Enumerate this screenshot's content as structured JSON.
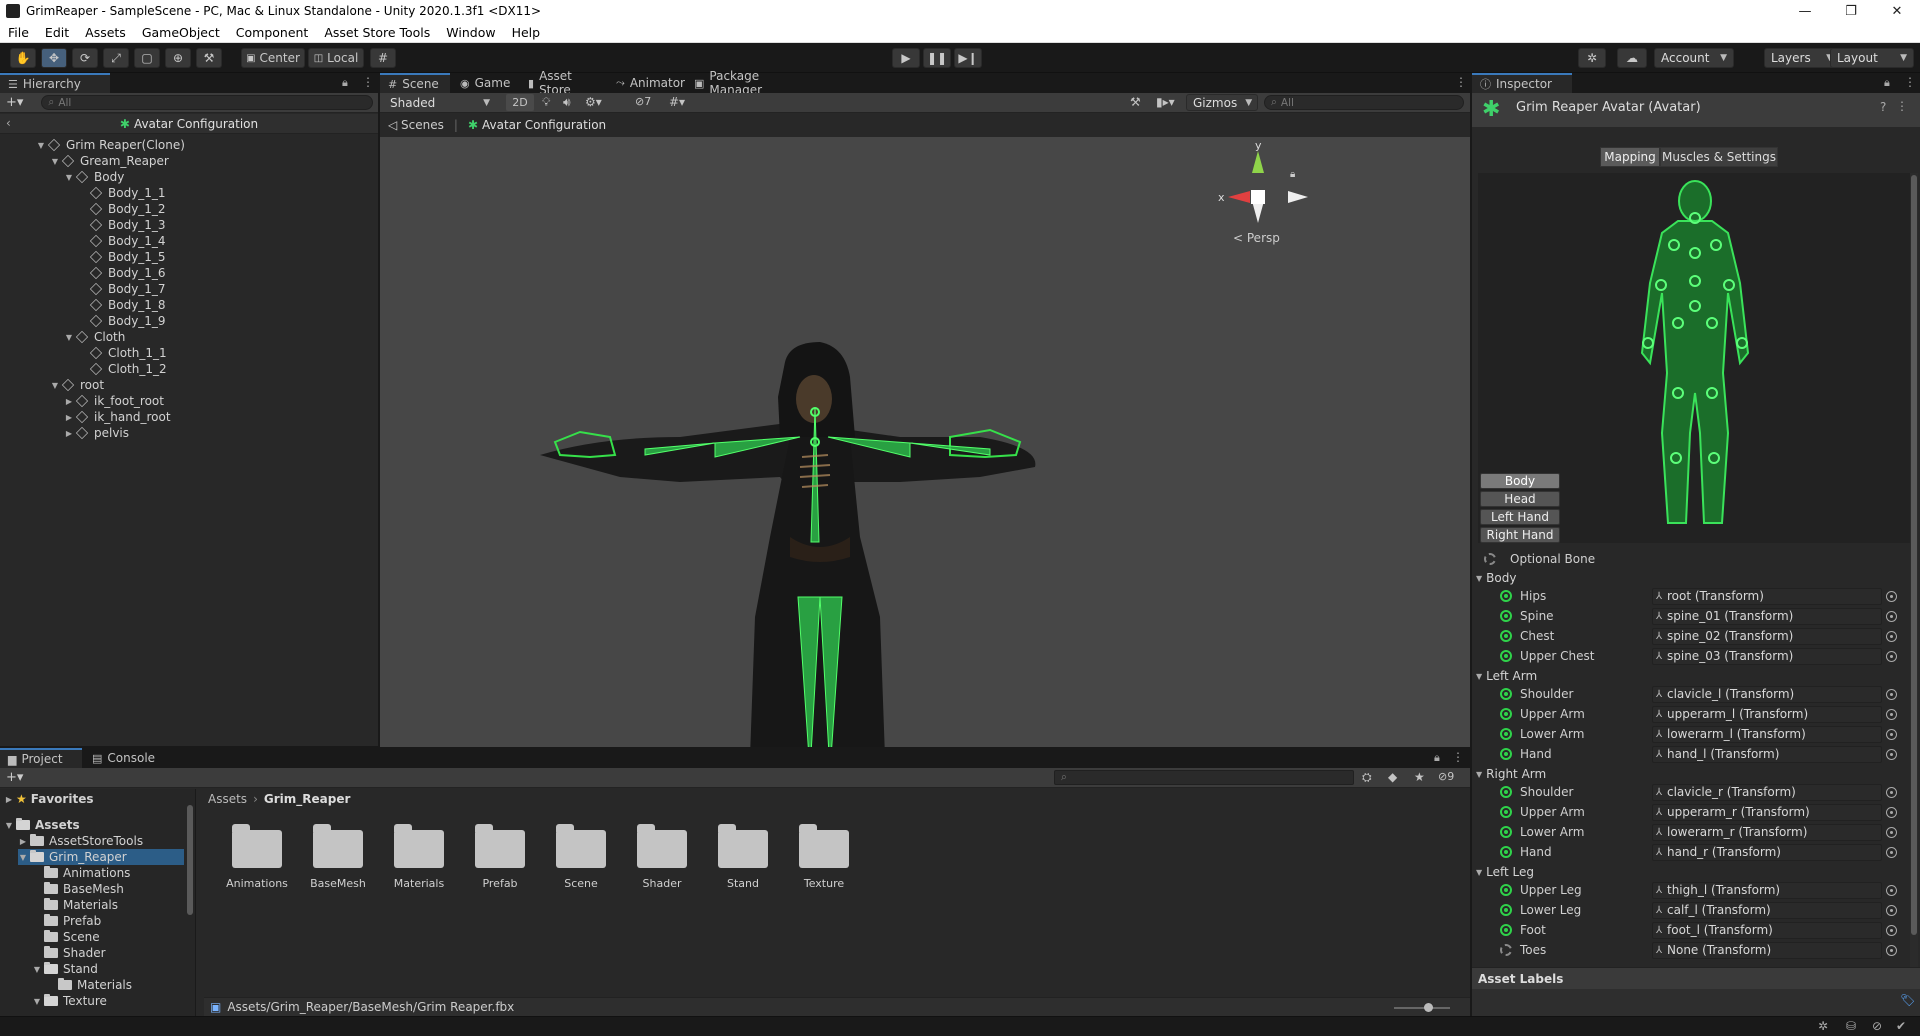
{
  "window": {
    "title": "GrimReaper - SampleScene - PC, Mac & Linux Standalone - Unity 2020.1.3f1 <DX11>"
  },
  "menu": [
    "File",
    "Edit",
    "Assets",
    "GameObject",
    "Component",
    "Asset Store Tools",
    "Window",
    "Help"
  ],
  "toolbar": {
    "pivot": "Center",
    "space": "Local",
    "account": "Account",
    "layers": "Layers",
    "layout": "Layout"
  },
  "hierarchy": {
    "tab": "Hierarchy",
    "search_placeholder": "All",
    "header": "Avatar Configuration",
    "items": [
      {
        "label": "Grim Reaper(Clone)",
        "depth": 0,
        "expand": "open"
      },
      {
        "label": "Gream_Reaper",
        "depth": 1,
        "expand": "open"
      },
      {
        "label": "Body",
        "depth": 2,
        "expand": "open"
      },
      {
        "label": "Body_1_1",
        "depth": 3,
        "expand": "none"
      },
      {
        "label": "Body_1_2",
        "depth": 3,
        "expand": "none"
      },
      {
        "label": "Body_1_3",
        "depth": 3,
        "expand": "none"
      },
      {
        "label": "Body_1_4",
        "depth": 3,
        "expand": "none"
      },
      {
        "label": "Body_1_5",
        "depth": 3,
        "expand": "none"
      },
      {
        "label": "Body_1_6",
        "depth": 3,
        "expand": "none"
      },
      {
        "label": "Body_1_7",
        "depth": 3,
        "expand": "none"
      },
      {
        "label": "Body_1_8",
        "depth": 3,
        "expand": "none"
      },
      {
        "label": "Body_1_9",
        "depth": 3,
        "expand": "none"
      },
      {
        "label": "Cloth",
        "depth": 2,
        "expand": "open"
      },
      {
        "label": "Cloth_1_1",
        "depth": 3,
        "expand": "none"
      },
      {
        "label": "Cloth_1_2",
        "depth": 3,
        "expand": "none"
      },
      {
        "label": "root",
        "depth": 1,
        "expand": "open"
      },
      {
        "label": "ik_foot_root",
        "depth": 2,
        "expand": "closed"
      },
      {
        "label": "ik_hand_root",
        "depth": 2,
        "expand": "closed"
      },
      {
        "label": "pelvis",
        "depth": 2,
        "expand": "closed"
      }
    ]
  },
  "scene_tabs": [
    {
      "label": "Scene",
      "icon": "#"
    },
    {
      "label": "Game",
      "icon": "◉"
    },
    {
      "label": "Asset Store",
      "icon": "▮"
    },
    {
      "label": "Animator",
      "icon": "⤳"
    },
    {
      "label": "Package Manager",
      "icon": "▣"
    }
  ],
  "scene": {
    "shading": "Shaded",
    "mode_2d": "2D",
    "hidden_count": "7",
    "gizmos": "Gizmos",
    "search_placeholder": "All",
    "breadcrumb_root": "Scenes",
    "breadcrumb_current": "Avatar Configuration",
    "gizmo_x": "x",
    "gizmo_y": "y",
    "projection": "Persp"
  },
  "inspector": {
    "tab": "Inspector",
    "title": "Grim Reaper Avatar (Avatar)",
    "mode_tabs": [
      "Mapping",
      "Muscles & Settings"
    ],
    "body_buttons": [
      "Body",
      "Head",
      "Left Hand",
      "Right Hand"
    ],
    "optional_bone": "Optional Bone",
    "sections": [
      {
        "name": "Body",
        "rows": [
          {
            "label": "Hips",
            "value": "root (Transform)",
            "optional": false
          },
          {
            "label": "Spine",
            "value": "spine_01 (Transform)",
            "optional": false
          },
          {
            "label": "Chest",
            "value": "spine_02 (Transform)",
            "optional": false
          },
          {
            "label": "Upper Chest",
            "value": "spine_03 (Transform)",
            "optional": false
          }
        ]
      },
      {
        "name": "Left Arm",
        "rows": [
          {
            "label": "Shoulder",
            "value": "clavicle_l (Transform)",
            "optional": false
          },
          {
            "label": "Upper Arm",
            "value": "upperarm_l (Transform)",
            "optional": false
          },
          {
            "label": "Lower Arm",
            "value": "lowerarm_l (Transform)",
            "optional": false
          },
          {
            "label": "Hand",
            "value": "hand_l (Transform)",
            "optional": false
          }
        ]
      },
      {
        "name": "Right Arm",
        "rows": [
          {
            "label": "Shoulder",
            "value": "clavicle_r (Transform)",
            "optional": false
          },
          {
            "label": "Upper Arm",
            "value": "upperarm_r (Transform)",
            "optional": false
          },
          {
            "label": "Lower Arm",
            "value": "lowerarm_r (Transform)",
            "optional": false
          },
          {
            "label": "Hand",
            "value": "hand_r (Transform)",
            "optional": false
          }
        ]
      },
      {
        "name": "Left Leg",
        "rows": [
          {
            "label": "Upper Leg",
            "value": "thigh_l (Transform)",
            "optional": false
          },
          {
            "label": "Lower Leg",
            "value": "calf_l (Transform)",
            "optional": false
          },
          {
            "label": "Foot",
            "value": "foot_l (Transform)",
            "optional": false
          },
          {
            "label": "Toes",
            "value": "None (Transform)",
            "optional": true
          }
        ]
      }
    ],
    "asset_labels": "Asset Labels"
  },
  "project": {
    "tabs": [
      "Project",
      "Console"
    ],
    "hidden_count": "9",
    "favorites": "Favorites",
    "tree": [
      {
        "label": "Assets",
        "depth": 0,
        "expand": "open",
        "bold": true
      },
      {
        "label": "AssetStoreTools",
        "depth": 1,
        "expand": "closed"
      },
      {
        "label": "Grim_Reaper",
        "depth": 1,
        "expand": "open",
        "selected": true
      },
      {
        "label": "Animations",
        "depth": 2,
        "expand": "none"
      },
      {
        "label": "BaseMesh",
        "depth": 2,
        "expand": "none"
      },
      {
        "label": "Materials",
        "depth": 2,
        "expand": "none"
      },
      {
        "label": "Prefab",
        "depth": 2,
        "expand": "none"
      },
      {
        "label": "Scene",
        "depth": 2,
        "expand": "none"
      },
      {
        "label": "Shader",
        "depth": 2,
        "expand": "none"
      },
      {
        "label": "Stand",
        "depth": 2,
        "expand": "open"
      },
      {
        "label": "Materials",
        "depth": 3,
        "expand": "none"
      },
      {
        "label": "Texture",
        "depth": 2,
        "expand": "open"
      }
    ],
    "breadcrumb": [
      "Assets",
      "Grim_Reaper"
    ],
    "folders": [
      "Animations",
      "BaseMesh",
      "Materials",
      "Prefab",
      "Scene",
      "Shader",
      "Stand",
      "Texture"
    ],
    "selected_path": "Assets/Grim_Reaper/BaseMesh/Grim Reaper.fbx"
  },
  "colors": {
    "accent": "#3a79bb",
    "bone_green": "#2fd24a",
    "panel": "#282828",
    "scene_bg": "#474747"
  }
}
